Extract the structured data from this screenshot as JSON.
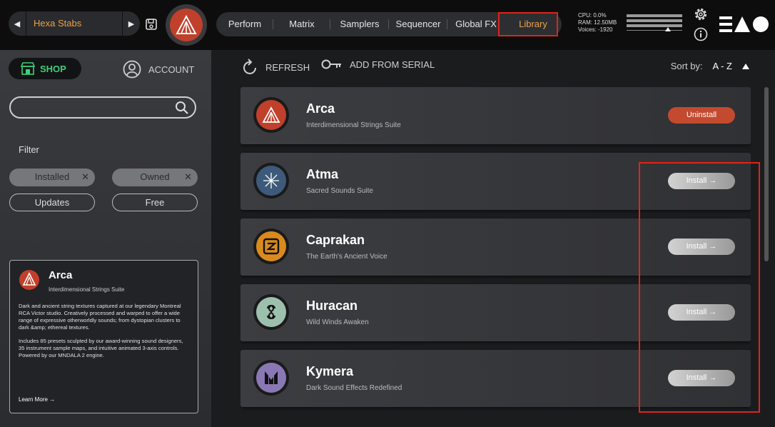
{
  "preset": {
    "name": "Hexa Stabs",
    "prev": "◀",
    "next": "▶"
  },
  "nav": {
    "tabs": [
      {
        "label": "Perform",
        "width": 80
      },
      {
        "label": "Matrix",
        "width": 82
      },
      {
        "label": "Samplers",
        "width": 82
      },
      {
        "label": "Sequencer",
        "width": 80
      },
      {
        "label": "Global FX",
        "width": 80
      },
      {
        "label": "Library",
        "width": 80
      }
    ],
    "active": "Library"
  },
  "stats": {
    "cpu": "CPU: 0.0%",
    "ram": "RAM: 12.50MB",
    "voices": "Voices: -1920"
  },
  "sidebar": {
    "shop_label": "SHOP",
    "account_label": "ACCOUNT",
    "search_placeholder": "",
    "filter_label": "Filter",
    "chips": {
      "installed": "Installed",
      "owned": "Owned",
      "updates": "Updates",
      "free": "Free"
    }
  },
  "info": {
    "title": "Arca",
    "subtitle": "Interdimensional Strings Suite",
    "desc1": "Dark and ancient string textures captured at our legendary Montreal RCA Victor studio. Creatively processed and warped to offer a wide range of expressive otherworldly sounds; from dystopian clusters to dark &amp; ethereal textures.",
    "desc2": "Includes 85 presets sculpted by our award-winning sound designers, 35 instrument sample maps, and intuitive animated 3-axis controls. Powered by our MNDALA 2 engine.",
    "learn_more": "Learn More →"
  },
  "toolbar": {
    "refresh": "REFRESH",
    "add_serial": "ADD FROM SERIAL",
    "sort_label": "Sort by:",
    "sort_value": "A - Z"
  },
  "library": [
    {
      "name": "Arca",
      "subtitle": "Interdimensional Strings Suite",
      "action": "Uninstall",
      "color": "#c0402b"
    },
    {
      "name": "Atma",
      "subtitle": "Sacred Sounds Suite",
      "action": "Install →",
      "color": "#3d5a7a"
    },
    {
      "name": "Caprakan",
      "subtitle": "The Earth's Ancient Voice",
      "action": "Install →",
      "color": "#d98a1f"
    },
    {
      "name": "Huracan",
      "subtitle": "Wild Winds Awaken",
      "action": "Install →",
      "color": "#9dbfae"
    },
    {
      "name": "Kymera",
      "subtitle": "Dark Sound Effects Redefined",
      "action": "Install →",
      "color": "#8a78b5"
    }
  ],
  "colors": {
    "accent": "#e8a24a",
    "shop": "#3fcf7a",
    "uninstall": "#c34a2f",
    "highlight": "#e0241b"
  }
}
